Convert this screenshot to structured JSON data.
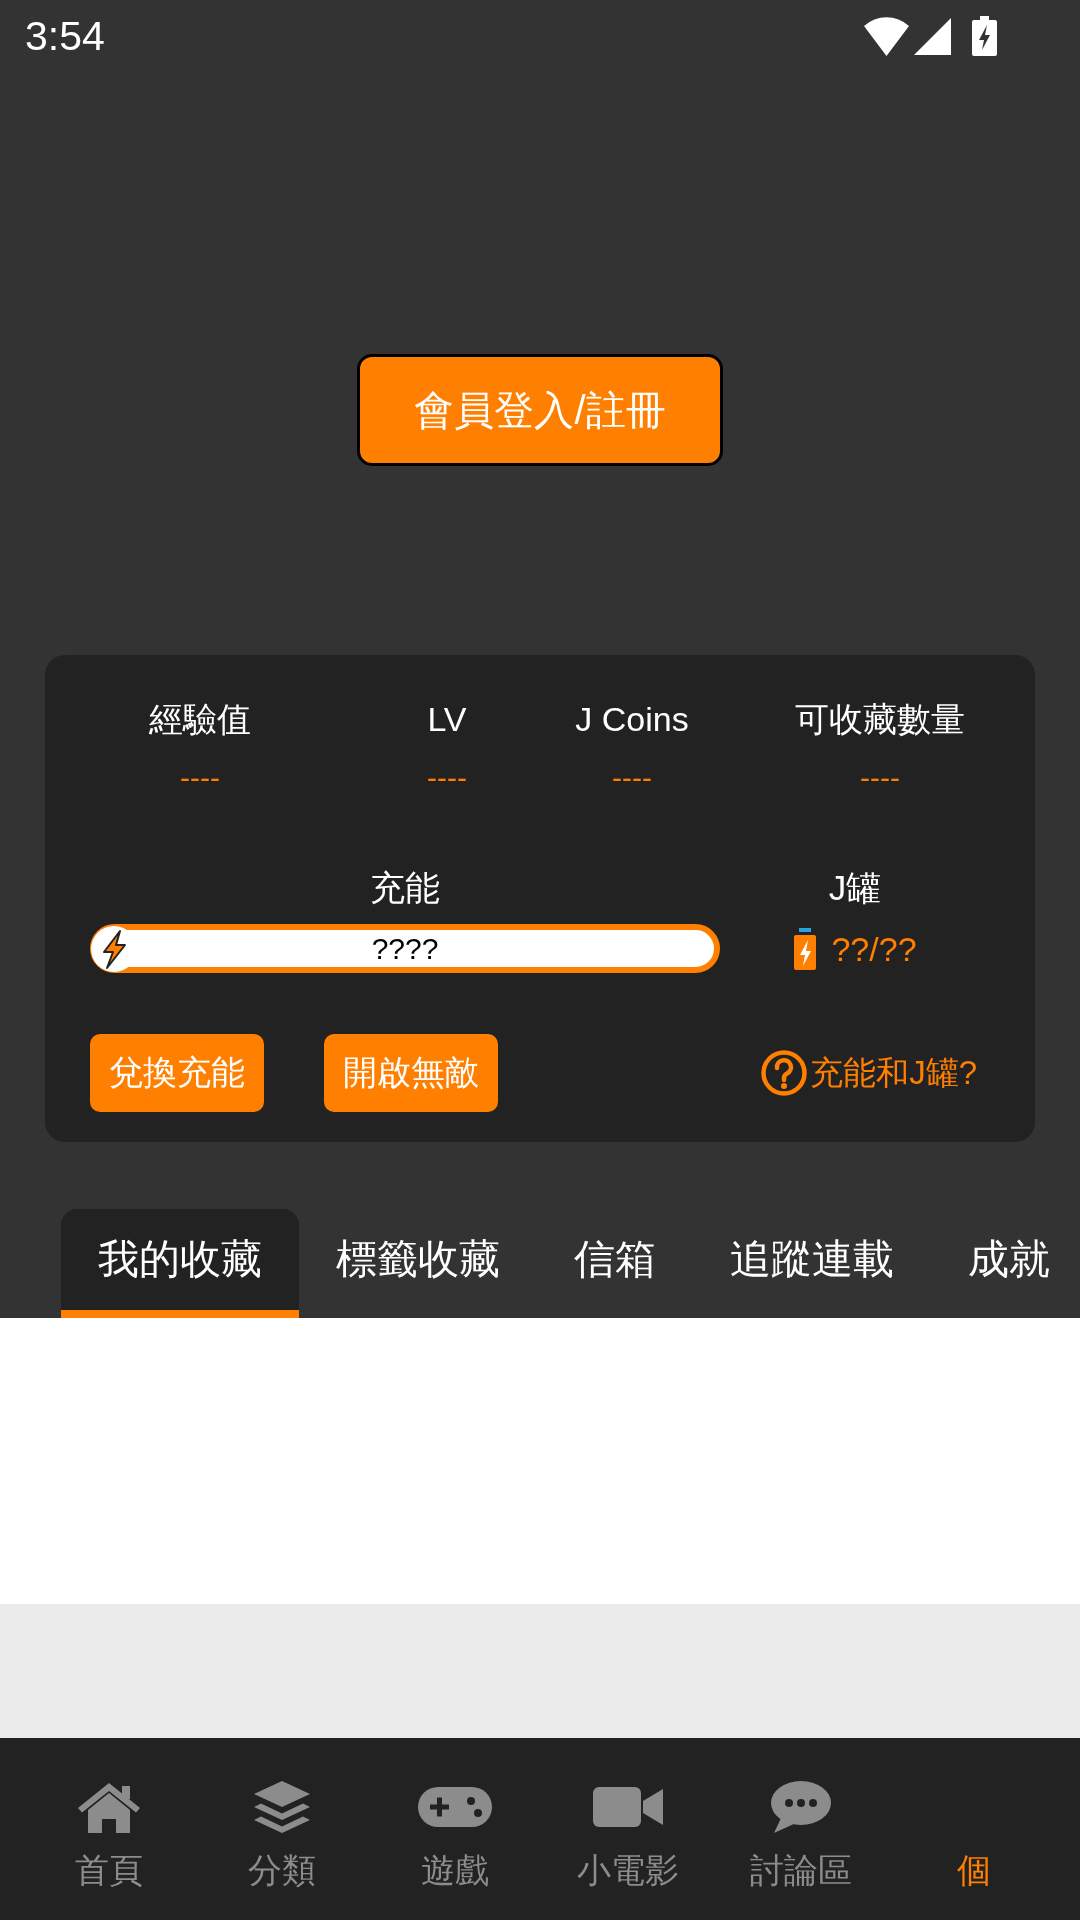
{
  "status_bar": {
    "time": "3:54"
  },
  "login_button": {
    "label": "會員登入/註冊"
  },
  "stats_card": {
    "stats": [
      {
        "label": "經驗值",
        "value": "----"
      },
      {
        "label": "LV",
        "value": "----"
      },
      {
        "label": "J Coins",
        "value": "----"
      },
      {
        "label": "可收藏數量",
        "value": "----"
      }
    ],
    "charge": {
      "label": "充能",
      "reading": "????"
    },
    "jar": {
      "label": "J罐",
      "value": "??/??"
    },
    "buttons": [
      {
        "label": "兌換充能"
      },
      {
        "label": "開啟無敵"
      }
    ],
    "help_link": {
      "label": "充能和J罐?"
    }
  },
  "tabs": [
    {
      "label": "我的收藏",
      "selected": true
    },
    {
      "label": "標籤收藏",
      "selected": false
    },
    {
      "label": "信箱",
      "selected": false
    },
    {
      "label": "追蹤連載",
      "selected": false
    },
    {
      "label": "成就",
      "selected": false
    }
  ],
  "bottom_nav": [
    {
      "label": "首頁",
      "selected": false
    },
    {
      "label": "分類",
      "selected": false
    },
    {
      "label": "遊戲",
      "selected": false
    },
    {
      "label": "小電影",
      "selected": false
    },
    {
      "label": "討論區",
      "selected": false
    },
    {
      "label": "個",
      "selected": true
    }
  ]
}
